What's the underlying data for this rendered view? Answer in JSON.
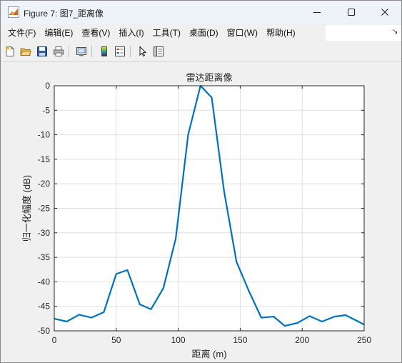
{
  "window": {
    "title": "Figure 7: 图7_距离像",
    "controls": {
      "minimize": "minimize-icon",
      "maximize": "maximize-icon",
      "close": "close-icon"
    }
  },
  "menu": {
    "items": [
      {
        "label": "文件(F)",
        "name": "menu-file"
      },
      {
        "label": "编辑(E)",
        "name": "menu-edit"
      },
      {
        "label": "查看(V)",
        "name": "menu-view"
      },
      {
        "label": "插入(I)",
        "name": "menu-insert"
      },
      {
        "label": "工具(T)",
        "name": "menu-tools"
      },
      {
        "label": "桌面(D)",
        "name": "menu-desktop"
      },
      {
        "label": "窗口(W)",
        "name": "menu-window"
      },
      {
        "label": "帮助(H)",
        "name": "menu-help"
      }
    ],
    "overflow_arrow": "↘"
  },
  "toolbar": {
    "buttons": [
      "new-figure-icon",
      "open-file-icon",
      "save-icon",
      "print-icon",
      "link-plot-icon",
      "insert-colorbar-icon",
      "insert-legend-icon",
      "edit-plot-icon",
      "property-inspector-icon"
    ]
  },
  "colors": {
    "line": "#0072bd",
    "axes_bg": "#ffffff",
    "figure_bg": "#f0f0f0",
    "grid": "#dfdfdf",
    "axis": "#262626"
  },
  "chart_data": {
    "type": "line",
    "title": "雷达距离像",
    "xlabel": "距离 (m)",
    "ylabel": "归一化幅度 (dB)",
    "xlim": [
      0,
      250
    ],
    "ylim": [
      -50,
      0
    ],
    "xticks": [
      0,
      50,
      100,
      150,
      200,
      250
    ],
    "yticks": [
      0,
      -5,
      -10,
      -15,
      -20,
      -25,
      -30,
      -35,
      -40,
      -45,
      -50
    ],
    "grid": true,
    "series": [
      {
        "x": [
          0,
          10,
          20,
          30,
          40,
          50,
          59,
          69,
          78,
          88,
          98,
          108,
          118,
          127,
          137,
          147,
          157,
          167,
          177,
          186,
          196,
          206,
          216,
          226,
          235,
          250
        ],
        "y": [
          -47.5,
          -48.1,
          -46.7,
          -47.3,
          -46.2,
          -38.4,
          -37.6,
          -44.6,
          -45.6,
          -41.3,
          -31.2,
          -10.0,
          0.0,
          -2.4,
          -21.5,
          -35.9,
          -41.9,
          -47.3,
          -47.1,
          -49.0,
          -48.4,
          -47.0,
          -48.1,
          -47.1,
          -46.8,
          -48.7
        ]
      }
    ]
  }
}
